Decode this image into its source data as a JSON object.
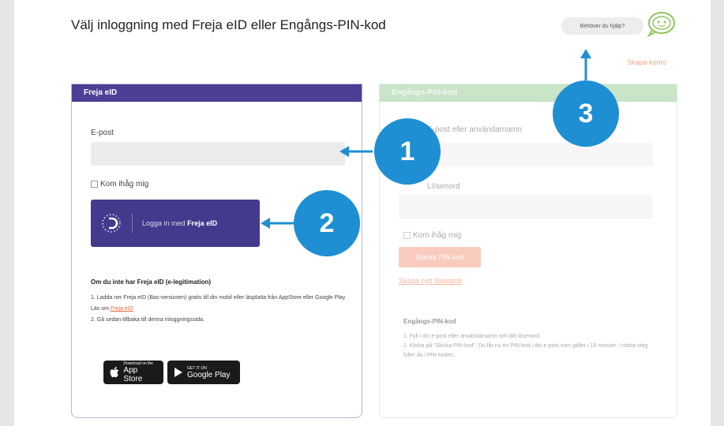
{
  "header": {
    "title": "Välj inloggning med Freja eID eller Engångs-PIN-kod",
    "help_label": "Behöver du hjälp?",
    "create_account": "Skapa konto"
  },
  "freja_card": {
    "header": "Freja eID",
    "email_label": "E-post",
    "email_value": "",
    "remember_label": "Kom ihåg mig",
    "button_prefix": "Logga in med ",
    "button_strong": "Freja eID",
    "info_title": "Om du inte har Freja eID (e-legitimation)",
    "step1_text": "1.  Ladda ner Freja eID (Bas-versionen) gratis till din mobil eller läsplatta från AppStore eller Google Play. Läs om ",
    "step1_link": "Freja eID",
    "step2_text": "2.  Gå sedan tillbaka till denna inloggningssida.",
    "appstore_small": "Download on the",
    "appstore_big": "App Store",
    "googleplay_small": "GET IT ON",
    "googleplay_big": "Google Play"
  },
  "pin_card": {
    "header": "Engångs-PIN-kod",
    "user_label": "E-post eller användarnamn",
    "password_label": "Lösenord",
    "remember_label": "Kom ihåg mig",
    "send_button": "Skicka PIN-kod",
    "reset_link": "Skapa nytt lösenord",
    "info_title": "Engångs-PIN-kod",
    "step1": "1.  Fyll i din e-post eller användarnamn och ditt lösenord.",
    "step2": "2.  Klicka på \"Skicka PIN-kod\". Du får nu en PIN-kod i din e-post som gäller i 15 minuter. I nästa steg fyller du i PIN-koden."
  },
  "callouts": {
    "one": "1",
    "two": "2",
    "three": "3"
  },
  "colors": {
    "freja_purple": "#4b3f96",
    "callout_blue": "#1e8fd3",
    "accent_orange": "#e8673f",
    "pin_green": "#c9e4c7"
  }
}
